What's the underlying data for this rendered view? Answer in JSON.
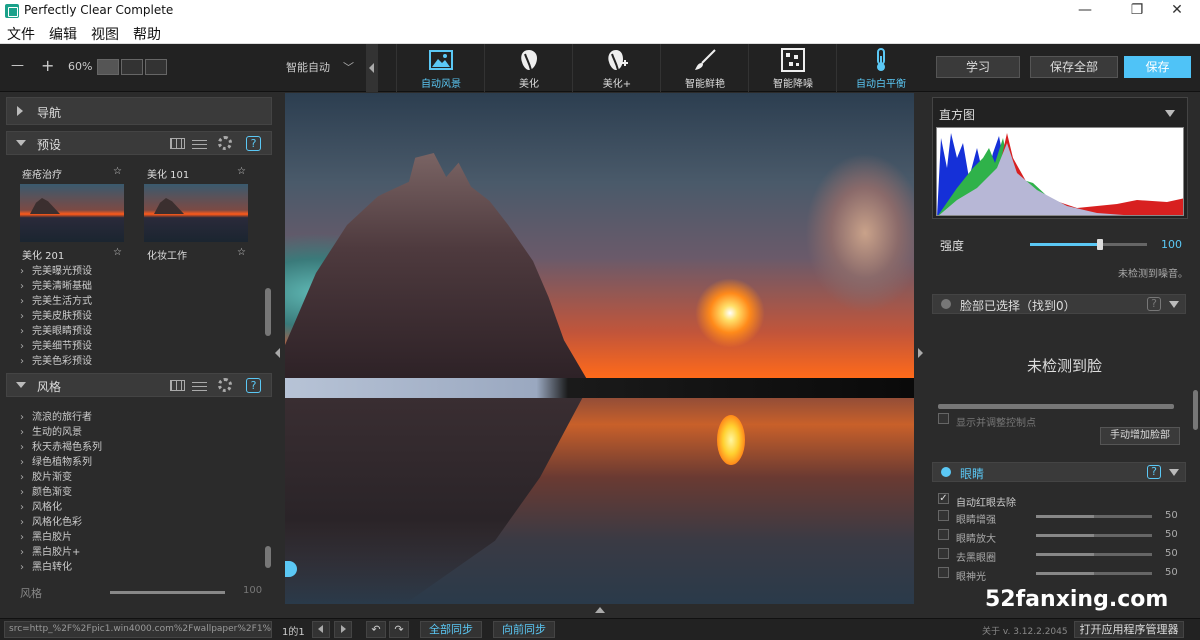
{
  "title": "Perfectly Clear Complete",
  "window": {
    "minimize": "—",
    "maximize": "❐",
    "close": "✕"
  },
  "menu": [
    "文件",
    "编辑",
    "视图",
    "帮助"
  ],
  "toolbar": {
    "zoom_minus": "—",
    "zoom_plus": "+",
    "zoom": "60%",
    "preset_select": "智能自动",
    "tools": [
      "自动风景",
      "美化",
      "美化+",
      "智能鲜艳",
      "智能降噪",
      "自动白平衡"
    ],
    "learn": "学习",
    "save_all": "保存全部",
    "save": "保存"
  },
  "left": {
    "nav": "导航",
    "presets": "预设",
    "thumbs": [
      "痤疮治疗",
      "美化 101",
      "美化 201",
      "化妆工作"
    ],
    "preset_items": [
      "完美曝光预设",
      "完美清晰基础",
      "完美生活方式",
      "完美皮肤预设",
      "完美眼睛预设",
      "完美细节预设",
      "完美色彩预设"
    ],
    "style": "风格",
    "style_items": [
      "流浪的旅行者",
      "生动的风景",
      "秋天赤褐色系列",
      "绿色植物系列",
      "胶片渐变",
      "颜色渐变",
      "风格化",
      "风格化色彩",
      "黑白胶片",
      "黑白胶片+",
      "黑白转化"
    ],
    "style_label": "风格",
    "style_value": "100"
  },
  "right": {
    "histogram": "直方图",
    "strength_label": "强度",
    "strength_value": "100",
    "strength_pct": 0.6,
    "no_noise": "未检测到噪音。",
    "face_header": "脸部已选择（找到0）",
    "no_face": "未检测到脸",
    "show_points": "显示并调整控制点",
    "add_face": "手动增加脸部",
    "eyes_header": "眼睛",
    "red_eye": "自动红眼去除",
    "eye_rows": [
      {
        "label": "眼睛增强",
        "value": "50"
      },
      {
        "label": "眼睛放大",
        "value": "50"
      },
      {
        "label": "去黑眼圈",
        "value": "50"
      },
      {
        "label": "眼神光",
        "value": "50"
      }
    ]
  },
  "status": {
    "src": "src=http_%2F%2Fpic1.win4000.com%2Fwallpaper%2F1%",
    "page": "1的1",
    "sync_all": "全部同步",
    "sync_forward": "向前同步",
    "version": "关于 v. 3.12.2.2045",
    "open_manager": "打开应用程序管理器"
  },
  "watermark": "52fanxing.com",
  "colors": {
    "accent": "#5bc8f5",
    "save": "#4fc3f7"
  }
}
